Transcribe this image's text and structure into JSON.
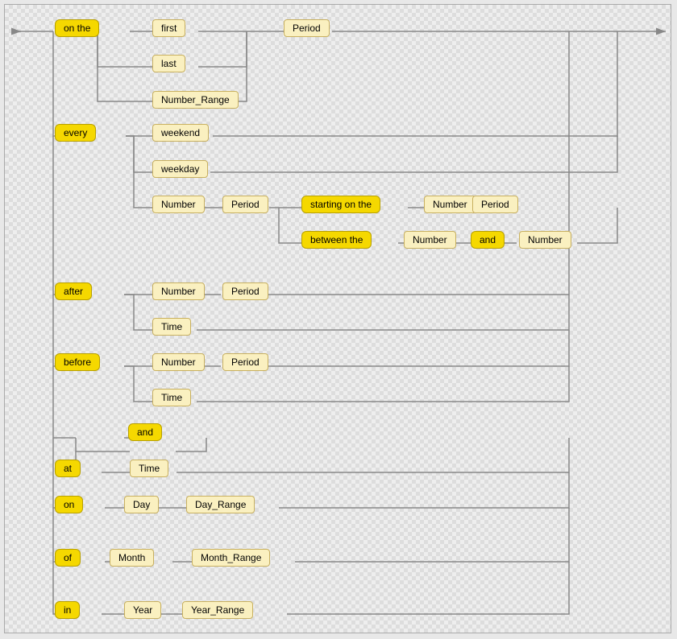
{
  "tokens": {
    "on_the": "on the",
    "first": "first",
    "last": "last",
    "number_range": "Number_Range",
    "period1": "Period",
    "every": "every",
    "weekend": "weekend",
    "weekday": "weekday",
    "number1": "Number",
    "period2": "Period",
    "starting_on_the": "starting on the",
    "number2": "Number",
    "period3": "Period",
    "between_the": "between the",
    "number3": "Number",
    "and1": "and",
    "number4": "Number",
    "after": "after",
    "number5": "Number",
    "period4": "Period",
    "time1": "Time",
    "before": "before",
    "number6": "Number",
    "period5": "Period",
    "time2": "Time",
    "and2": "and",
    "time3": "Time",
    "at": "at",
    "on": "on",
    "day": "Day",
    "day_range": "Day_Range",
    "of": "of",
    "month": "Month",
    "month_range": "Month_Range",
    "in": "in",
    "year": "Year",
    "year_range": "Year_Range"
  }
}
